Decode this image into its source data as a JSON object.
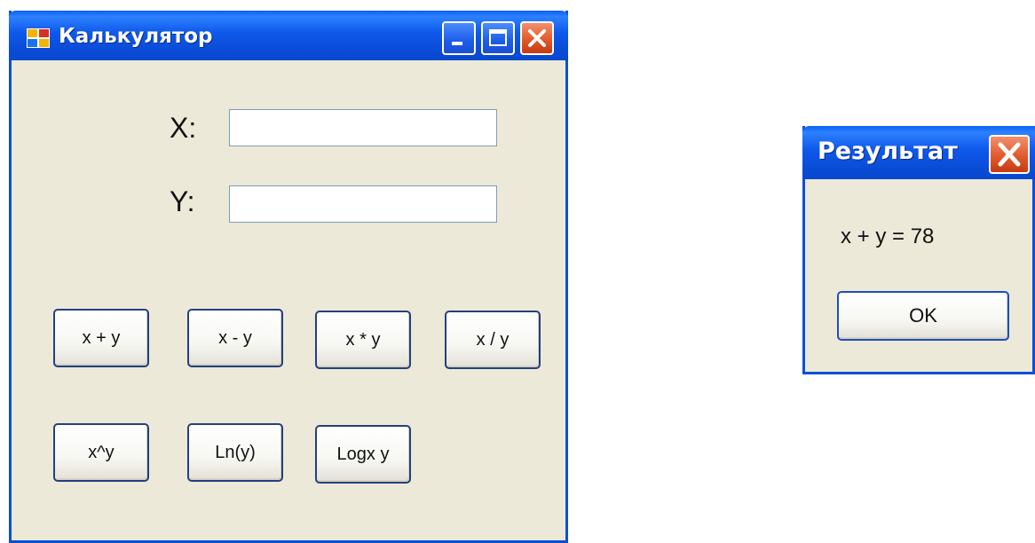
{
  "calculator": {
    "title": "Калькулятор",
    "x_label": "X:",
    "y_label": "Y:",
    "x_value": "",
    "y_value": "",
    "buttons_row1": [
      "x + y",
      "x - y",
      "x * y",
      "x / y"
    ],
    "buttons_row2": [
      "x^y",
      "Ln(y)",
      "Logx y"
    ]
  },
  "result_dialog": {
    "title": "Результат",
    "message": "x + y = 78",
    "ok_label": "OK"
  },
  "colors": {
    "titlebar": "#0a4fd8",
    "window_bg": "#ece9d8",
    "close_button": "#e15a2c",
    "button_border": "#23407e"
  }
}
